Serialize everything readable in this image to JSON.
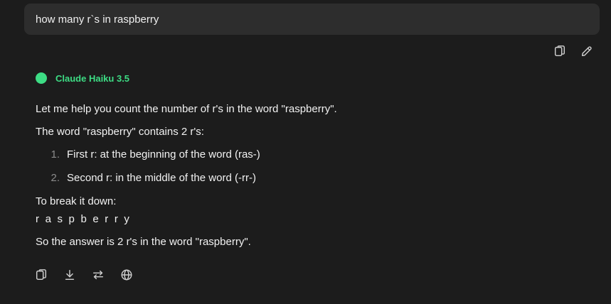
{
  "user_message": {
    "text": "how many r`s in raspberry"
  },
  "message_actions": {
    "copy_icon": "copy-icon",
    "edit_icon": "edit-icon"
  },
  "model": {
    "name": "Claude Haiku 3.5",
    "color": "#3ddc84"
  },
  "answer": {
    "intro": "Let me help you count the number of r's in the word \"raspberry\".",
    "statement": "The word \"raspberry\" contains 2 r's:",
    "list": [
      {
        "num": "1.",
        "text": "First r: at the beginning of the word (ras-)"
      },
      {
        "num": "2.",
        "text": "Second r: in the middle of the word (-rr-)"
      }
    ],
    "breakdown_label": "To break it down:",
    "spelled": "r a s p b e r r y",
    "conclusion": "So the answer is 2 r's in the word \"raspberry\"."
  },
  "bottom_actions": [
    "copy-icon",
    "download-icon",
    "regenerate-icon",
    "globe-icon"
  ],
  "colors": {
    "background": "#1c1c1c",
    "bubble": "#2d2d2d",
    "accent": "#3ddc84"
  }
}
